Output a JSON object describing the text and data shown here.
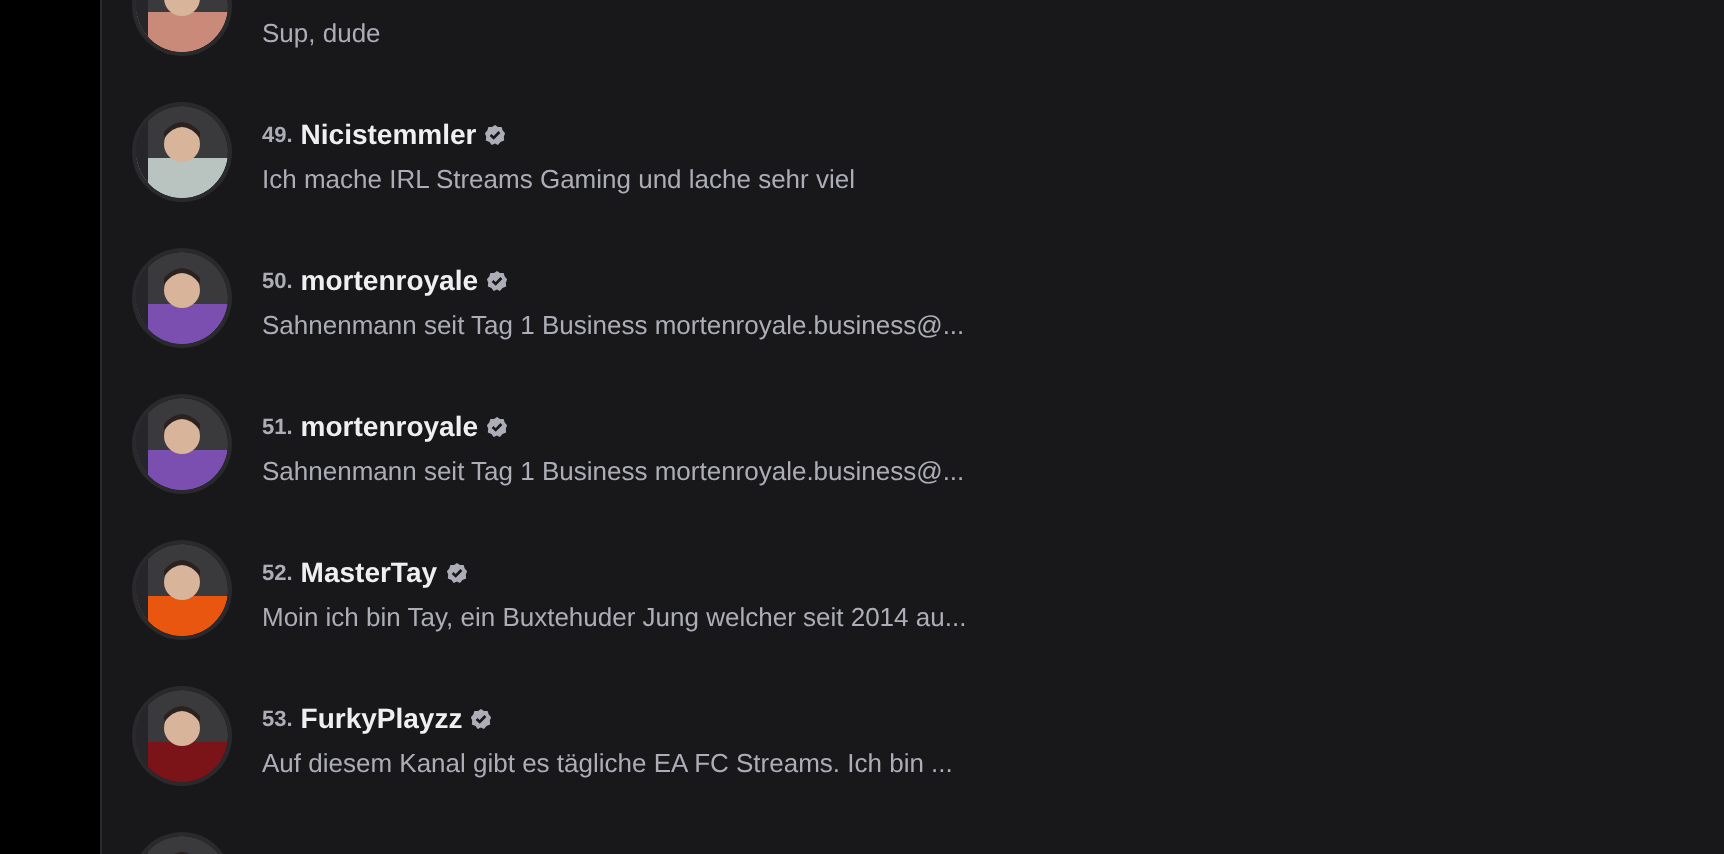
{
  "channels": [
    {
      "description": "Sup, dude",
      "avatar": {
        "kind": "picture"
      }
    },
    {
      "rank": "49.",
      "name": "Nicistemmler",
      "verified": true,
      "description": "Ich mache IRL Streams Gaming und lache sehr viel",
      "avatar": {
        "kind": "picture"
      }
    },
    {
      "rank": "50.",
      "name": "mortenroyale",
      "verified": true,
      "description": "Sahnenmann seit Tag 1 Business mortenroyale.business@...",
      "avatar": {
        "kind": "picture"
      }
    },
    {
      "rank": "51.",
      "name": "mortenroyale",
      "verified": true,
      "description": "Sahnenmann seit Tag 1 Business mortenroyale.business@...",
      "avatar": {
        "kind": "picture"
      }
    },
    {
      "rank": "52.",
      "name": "MasterTay",
      "verified": true,
      "description": "Moin ich bin Tay, ein Buxtehuder Jung welcher seit 2014 au...",
      "avatar": {
        "kind": "picture"
      }
    },
    {
      "rank": "53.",
      "name": "FurkyPlayzz",
      "verified": true,
      "description": "Auf diesem Kanal gibt es tägliche EA FC Streams. Ich bin ...",
      "avatar": {
        "kind": "picture"
      }
    },
    {
      "avatar": {
        "kind": "picture"
      }
    }
  ]
}
